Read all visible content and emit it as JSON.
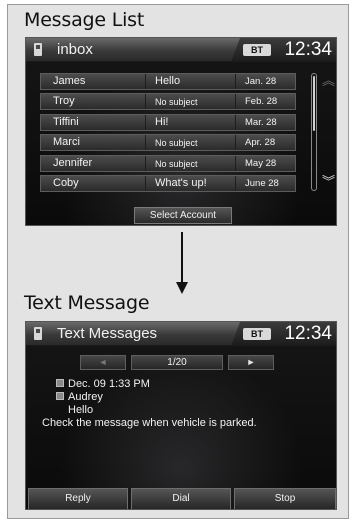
{
  "sections": {
    "message_list_title": "Message List",
    "text_message_title": "Text Message"
  },
  "message_list": {
    "header": {
      "title": "inbox",
      "status": "BT",
      "clock": "12:34"
    },
    "rows": [
      {
        "name": "James",
        "subject": "Hello",
        "date": "Jan. 28"
      },
      {
        "name": "Troy",
        "subject": "No subject",
        "date": "Feb. 28"
      },
      {
        "name": "Tiffini",
        "subject": "Hi!",
        "date": "Mar. 28"
      },
      {
        "name": "Marci",
        "subject": "No subject",
        "date": "Apr. 28"
      },
      {
        "name": "Jennifer",
        "subject": "No subject",
        "date": "May 28"
      },
      {
        "name": "Coby",
        "subject": "What's up!",
        "date": "June 28"
      }
    ],
    "scroll_up_icon": "chevron-up-icon",
    "scroll_down_icon": "chevron-down-icon",
    "select_account_label": "Select Account"
  },
  "text_message": {
    "header": {
      "title": "Text Messages",
      "status": "BT",
      "clock": "12:34"
    },
    "pager": {
      "prev": "◄",
      "count": "1/20",
      "next": "►"
    },
    "detail": {
      "date": "Dec. 09 1:33 PM",
      "sender": "Audrey",
      "subject": "Hello",
      "body": "Check the message when vehicle is parked."
    },
    "buttons": {
      "reply": "Reply",
      "dial": "Dial",
      "stop": "Stop"
    }
  }
}
